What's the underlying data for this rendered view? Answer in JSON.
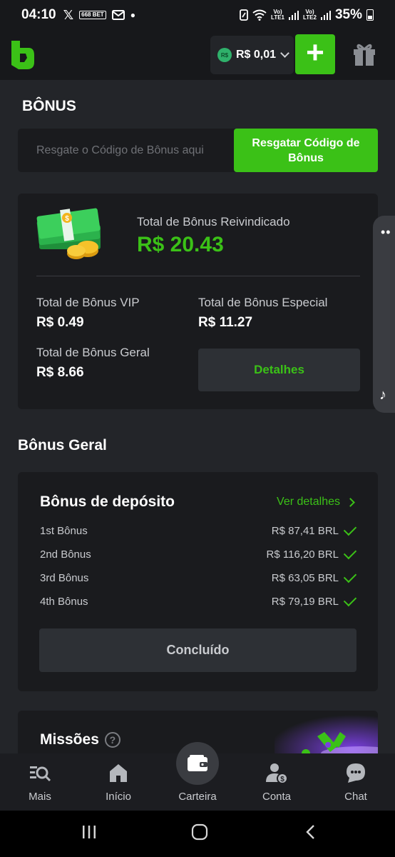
{
  "status_bar": {
    "time": "04:10",
    "bet_badge": "668 BET",
    "battery": "35%"
  },
  "header": {
    "currency_badge": "R$",
    "balance": "R$ 0,01",
    "add_button_label": "+"
  },
  "page": {
    "title": "BÔNUS"
  },
  "redeem": {
    "placeholder": "Resgate o Código de Bônus aqui",
    "button_label": "Resgatar Código de Bônus"
  },
  "summary": {
    "claimed_label": "Total de Bônus Reivindicado",
    "claimed_value": "R$ 20.43",
    "vip_label": "Total de Bônus VIP",
    "vip_value": "R$ 0.49",
    "special_label": "Total de Bônus Especial",
    "special_value": "R$ 11.27",
    "general_label": "Total de Bônus Geral",
    "general_value": "R$ 8.66",
    "details_button": "Detalhes"
  },
  "general_section": {
    "title": "Bônus Geral",
    "deposit": {
      "title": "Bônus de depósito",
      "see_details": "Ver detalhes",
      "rows": [
        {
          "label": "1st Bônus",
          "amount": "R$ 87,41 BRL"
        },
        {
          "label": "2nd Bônus",
          "amount": "R$ 116,20 BRL"
        },
        {
          "label": "3rd Bônus",
          "amount": "R$ 63,05 BRL"
        },
        {
          "label": "4th Bônus",
          "amount": "R$ 79,19 BRL"
        }
      ],
      "done_button": "Concluído"
    }
  },
  "missions": {
    "title": "Missões",
    "help_symbol": "?"
  },
  "bottom_nav": {
    "items": [
      {
        "label": "Mais",
        "icon": "search-list-icon"
      },
      {
        "label": "Início",
        "icon": "home-icon"
      },
      {
        "label": "Carteira",
        "icon": "wallet-icon"
      },
      {
        "label": "Conta",
        "icon": "account-icon"
      },
      {
        "label": "Chat",
        "icon": "chat-icon"
      }
    ]
  },
  "colors": {
    "accent": "#3bc117",
    "background": "#232529",
    "card": "#1a1b1e",
    "header": "#17181b"
  }
}
